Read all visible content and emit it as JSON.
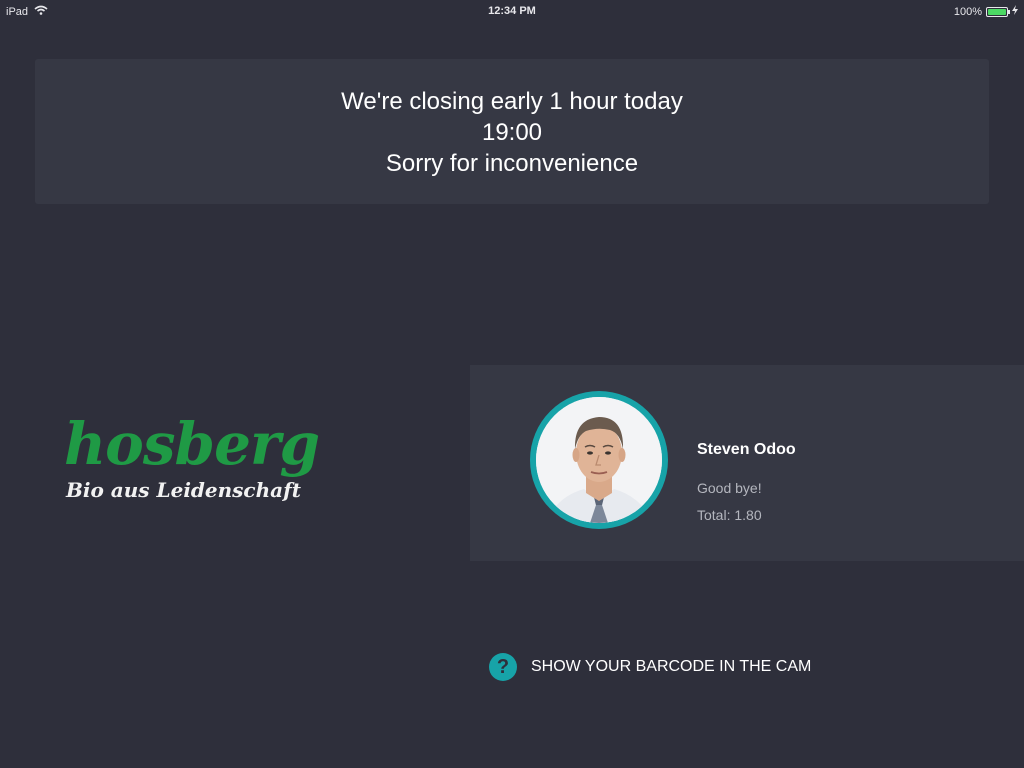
{
  "status_bar": {
    "device": "iPad",
    "time": "12:34 PM",
    "battery_percent": "100%",
    "battery_level": 1.0,
    "icons": [
      "wifi-icon",
      "battery-icon",
      "charging-icon"
    ]
  },
  "notice": {
    "line1": "We're closing early 1 hour today",
    "line2": "19:00",
    "line3": "Sorry for inconvenience"
  },
  "logo": {
    "name": "hosberg",
    "tagline": "Bio aus Leidenschaft",
    "color": "#1f9a45"
  },
  "customer": {
    "name": "Steven Odoo",
    "message": "Good bye!",
    "total": "Total: 1.80",
    "avatar_ring_color": "#17a3a8"
  },
  "barcode_hint": {
    "icon": "help-icon",
    "text": "SHOW YOUR BARCODE IN THE CAM"
  }
}
